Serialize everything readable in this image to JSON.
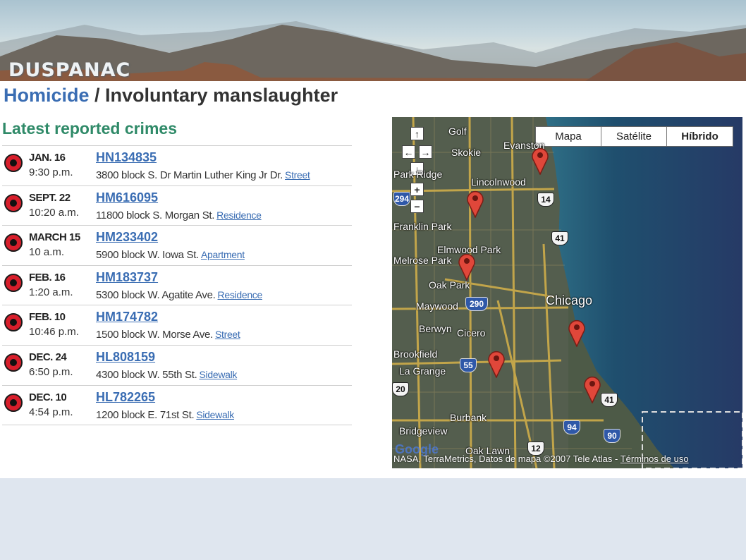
{
  "header": {
    "brand": "DUSPANAC"
  },
  "page": {
    "category": "Homicide",
    "separator": " / ",
    "title": "Involuntary manslaughter"
  },
  "section": {
    "title": "Latest reported crimes"
  },
  "crimes": [
    {
      "date": "JAN. 16",
      "time": "9:30 p.m.",
      "case": "HN134835",
      "location": "3800 block S. Dr Martin Luther King Jr Dr.",
      "type": "Street"
    },
    {
      "date": "SEPT. 22",
      "time": "10:20 a.m.",
      "case": "HM616095",
      "location": "11800 block S. Morgan St.",
      "type": "Residence"
    },
    {
      "date": "MARCH 15",
      "time": "10 a.m.",
      "case": "HM233402",
      "location": "5900 block W. Iowa St.",
      "type": "Apartment"
    },
    {
      "date": "FEB. 16",
      "time": "1:20 a.m.",
      "case": "HM183737",
      "location": "5300 block W. Agatite Ave.",
      "type": "Residence"
    },
    {
      "date": "FEB. 10",
      "time": "10:46 p.m.",
      "case": "HM174782",
      "location": "1500 block W. Morse Ave.",
      "type": "Street"
    },
    {
      "date": "DEC. 24",
      "time": "6:50 p.m.",
      "case": "HL808159",
      "location": "4300 block W. 55th St.",
      "type": "Sidewalk"
    },
    {
      "date": "DEC. 10",
      "time": "4:54 p.m.",
      "case": "HL782265",
      "location": "1200 block E. 71st St.",
      "type": "Sidewalk"
    }
  ],
  "map": {
    "types": [
      "Mapa",
      "Satélite",
      "Híbrido"
    ],
    "selected_type": "Híbrido",
    "controls": {
      "up": "↑",
      "left": "←",
      "right": "→",
      "down": "↓",
      "zoom_in": "+",
      "zoom_out": "−"
    },
    "labels": [
      "Golf",
      "Skokie",
      "Evanston",
      "Lincolnwood",
      "Park Ridge",
      "Elmwood Park",
      "Oak Park",
      "Chicago",
      "Maywood",
      "Berwyn",
      "Cicero",
      "Brookfield",
      "La Grange",
      "Burbank",
      "Oak Lawn",
      "Bridgeview",
      "Franklin Park",
      "Melrose Park"
    ],
    "shields": [
      "14",
      "41",
      "290",
      "94",
      "55",
      "41",
      "94",
      "90",
      "12",
      "294",
      "20"
    ],
    "logo": "Google",
    "copyright": "NASA, TerraMetrics, Datos de mapa ©2007 Tele Atlas - ",
    "terms": "Términos de uso"
  }
}
